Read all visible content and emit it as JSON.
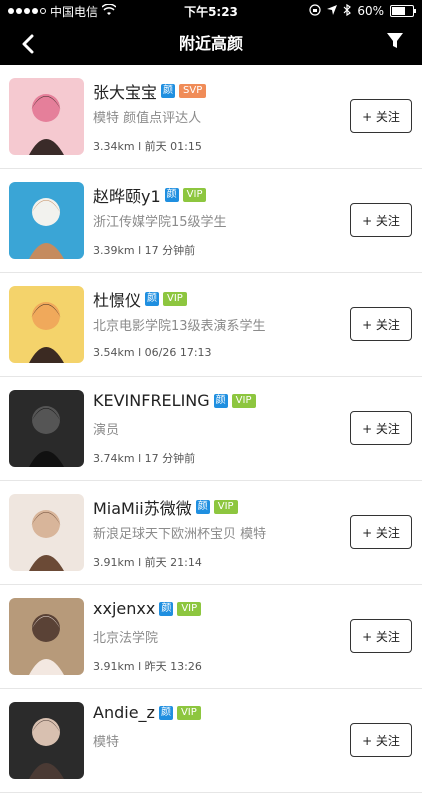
{
  "status": {
    "carrier": "中国电信",
    "time": "下午5:23",
    "battery": "60%",
    "battery_level": 0.6
  },
  "header": {
    "title": "附近高颜",
    "back_icon": "chevron-left-icon",
    "filter_icon": "filter-icon"
  },
  "colors": {
    "yan_badge": "#1f8fe0",
    "vip_badge": "#8dc63f",
    "svp_badge": "#f08c58"
  },
  "users": [
    {
      "name": "张大宝宝",
      "yan": "颜",
      "level": "SVP",
      "desc": "模特 颜值点评达人",
      "distance": "3.34km",
      "time": "前天 01:15",
      "follow": "+ 关注"
    },
    {
      "name": "赵晔颐y1",
      "yan": "颜",
      "level": "VIP",
      "desc": "浙江传媒学院15级学生",
      "distance": "3.39km",
      "time": "17 分钟前",
      "follow": "+ 关注"
    },
    {
      "name": "杜憬仪",
      "yan": "颜",
      "level": "VIP",
      "desc": "北京电影学院13级表演系学生",
      "distance": "3.54km",
      "time": "06/26 17:13",
      "follow": "+ 关注"
    },
    {
      "name": "KEVINFRELING",
      "yan": "颜",
      "level": "VIP",
      "desc": "演员",
      "distance": "3.74km",
      "time": "17 分钟前",
      "follow": "+ 关注"
    },
    {
      "name": "MiaMii苏微微",
      "yan": "颜",
      "level": "VIP",
      "desc": "新浪足球天下欧洲杯宝贝  模特",
      "distance": "3.91km",
      "time": "前天 21:14",
      "follow": "+ 关注"
    },
    {
      "name": "xxjenxx",
      "yan": "颜",
      "level": "VIP",
      "desc": "北京法学院",
      "distance": "3.91km",
      "time": "昨天 13:26",
      "follow": "+ 关注"
    },
    {
      "name": "Andie_z",
      "yan": "颜",
      "level": "VIP",
      "desc": "模特",
      "distance": "",
      "time": "",
      "follow": "+ 关注"
    }
  ]
}
